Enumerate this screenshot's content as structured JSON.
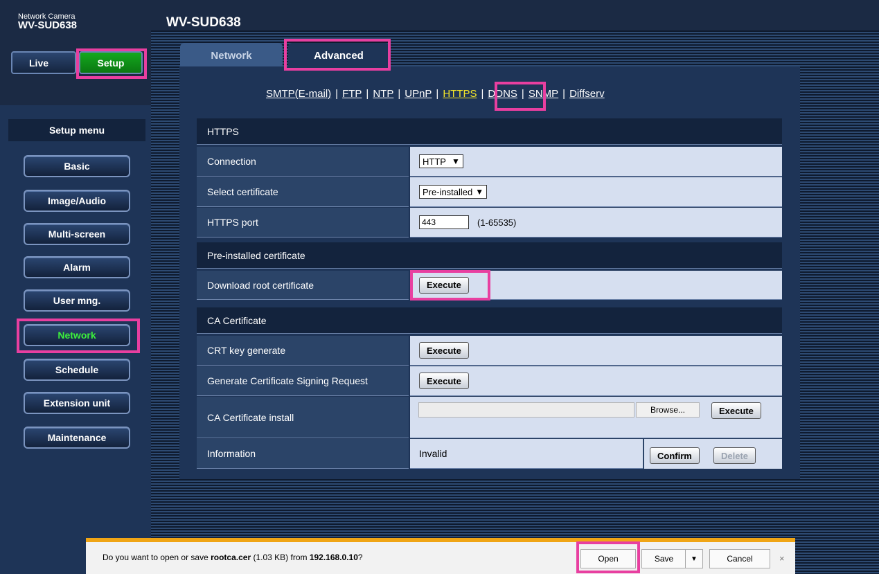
{
  "header": {
    "brand_line1": "Network Camera",
    "brand_line2": "WV-SUD638",
    "page_title": "WV-SUD638"
  },
  "mode_buttons": {
    "live": "Live",
    "setup": "Setup"
  },
  "sidebar": {
    "heading": "Setup menu",
    "items": [
      {
        "label": "Basic"
      },
      {
        "label": "Image/Audio"
      },
      {
        "label": "Multi-screen"
      },
      {
        "label": "Alarm"
      },
      {
        "label": "User mng."
      },
      {
        "label": "Network",
        "active": true
      },
      {
        "label": "Schedule"
      },
      {
        "label": "Extension unit"
      },
      {
        "label": "Maintenance"
      }
    ]
  },
  "tabs": [
    {
      "label": "Network"
    },
    {
      "label": "Advanced",
      "selected": true
    }
  ],
  "links": [
    "SMTP(E-mail)",
    "FTP",
    "NTP",
    "UPnP",
    "HTTPS",
    "DDNS",
    "SNMP",
    "Diffserv"
  ],
  "links_current": "HTTPS",
  "https": {
    "section_title": "HTTPS",
    "connection_label": "Connection",
    "connection_value": "HTTP",
    "select_cert_label": "Select certificate",
    "select_cert_value": "Pre-installed",
    "port_label": "HTTPS port",
    "port_value": "443",
    "port_range": "(1-65535)"
  },
  "preinstalled": {
    "section_title": "Pre-installed certificate",
    "download_label": "Download root certificate",
    "execute_label": "Execute"
  },
  "ca": {
    "section_title": "CA Certificate",
    "crt_label": "CRT key generate",
    "csr_label": "Generate Certificate Signing Request",
    "install_label": "CA Certificate install",
    "browse_label": "Browse...",
    "execute_label": "Execute",
    "info_label": "Information",
    "info_value": "Invalid",
    "confirm_label": "Confirm",
    "delete_label": "Delete"
  },
  "download_bar": {
    "msg_prefix": "Do you want to open or save ",
    "file_name": "rootca.cer",
    "file_size": " (1.03 KB) from ",
    "host": "192.168.0.10",
    "msg_suffix": "?",
    "open_label": "Open",
    "save_label": "Save",
    "cancel_label": "Cancel",
    "close_glyph": "×"
  },
  "colors": {
    "highlight": "#e83fa0",
    "active_green": "#14a81e",
    "link_current": "#f5e829"
  }
}
